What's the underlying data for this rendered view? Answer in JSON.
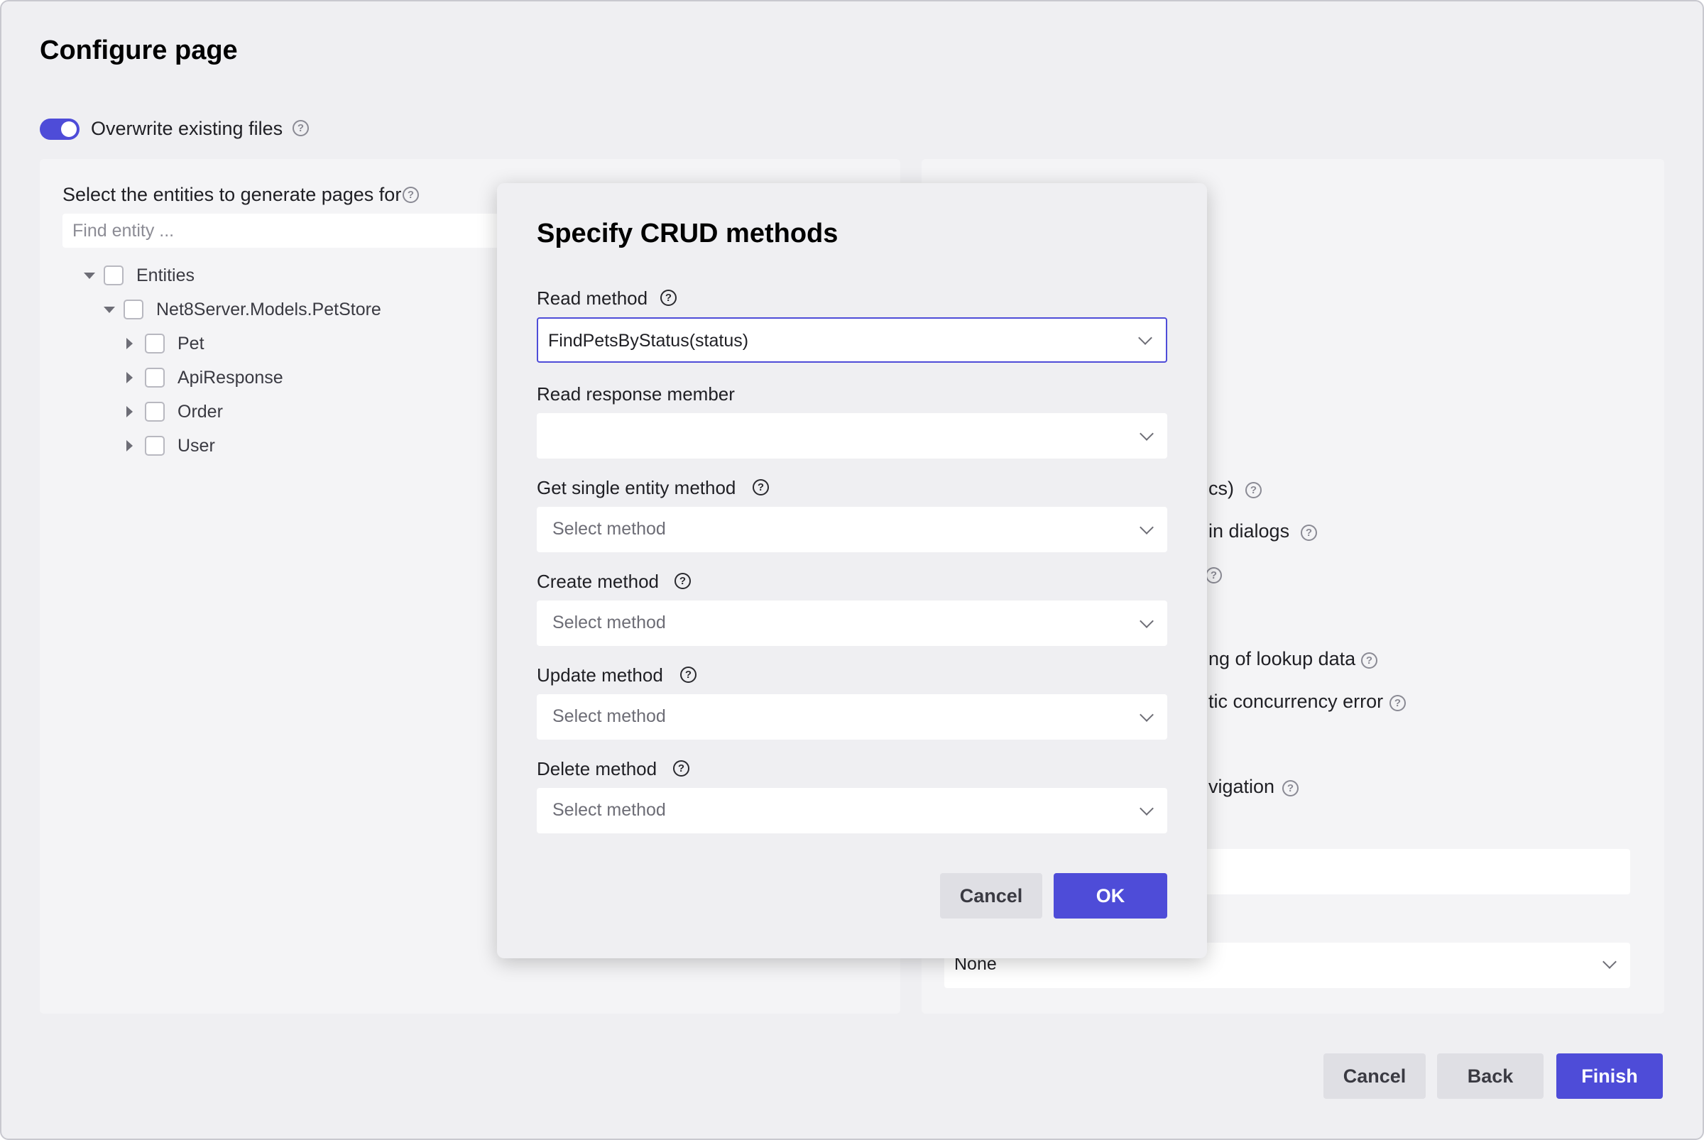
{
  "page": {
    "title": "Configure page"
  },
  "overwrite": {
    "label": "Overwrite existing files",
    "enabled": true,
    "help": "?"
  },
  "entities": {
    "label": "Select the entities to generate pages for",
    "help": "?",
    "search_placeholder": "Find entity ...",
    "tree": {
      "root": "Entities",
      "namespace": "Net8Server.Models.PetStore",
      "items": [
        "Pet",
        "ApiResponse",
        "Order",
        "User"
      ]
    }
  },
  "right_panel": {
    "fragments": [
      "cs)",
      "in dialogs",
      "ng of lookup data",
      "tic concurrency error",
      "vigation"
    ],
    "select_value": "None"
  },
  "footer": {
    "cancel": "Cancel",
    "back": "Back",
    "finish": "Finish"
  },
  "dialog": {
    "title": "Specify CRUD methods",
    "read_method": {
      "label": "Read method",
      "value": "FindPetsByStatus(status)"
    },
    "read_response_member": {
      "label": "Read response member",
      "value": ""
    },
    "get_single": {
      "label": "Get single entity method",
      "placeholder": "Select method"
    },
    "create": {
      "label": "Create method",
      "placeholder": "Select method"
    },
    "update": {
      "label": "Update method",
      "placeholder": "Select method"
    },
    "delete": {
      "label": "Delete method",
      "placeholder": "Select method"
    },
    "cancel": "Cancel",
    "ok": "OK"
  },
  "colors": {
    "accent": "#4e4cd8",
    "background": "#efeff2",
    "panel": "#f4f4f6"
  }
}
